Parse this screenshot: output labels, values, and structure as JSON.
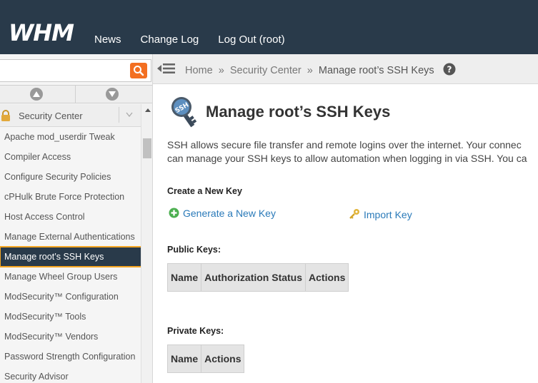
{
  "brand": {
    "logo_text": "WHM"
  },
  "topnav": {
    "items": [
      "News",
      "Change Log",
      "Log Out (root)"
    ]
  },
  "search": {
    "value": "",
    "placeholder": ""
  },
  "sidebar": {
    "category": "Security Center",
    "items": [
      "Apache mod_userdir Tweak",
      "Compiler Access",
      "Configure Security Policies",
      "cPHulk Brute Force Protection",
      "Host Access Control",
      "Manage External Authentications",
      "Manage root’s SSH Keys",
      "Manage Wheel Group Users",
      "ModSecurity™ Configuration",
      "ModSecurity™ Tools",
      "ModSecurity™ Vendors",
      "Password Strength Configuration",
      "Security Advisor"
    ],
    "active_index": 6
  },
  "breadcrumb": {
    "home": "Home",
    "section": "Security Center",
    "separator": "»",
    "current": "Manage root’s SSH Keys"
  },
  "page": {
    "title": "Manage root’s SSH Keys",
    "icon_text": "SSH",
    "description_line1": "SSH allows secure file transfer and remote logins over the internet. Your connec",
    "description_line2": "can manage your SSH keys to allow automation when logging in via SSH. You ca",
    "create_heading": "Create a New Key",
    "generate_label": "Generate a New Key",
    "import_label": "Import Key",
    "public_heading": "Public Keys:",
    "public_columns": [
      "Name",
      "Authorization Status",
      "Actions"
    ],
    "private_heading": "Private Keys:",
    "private_columns": [
      "Name",
      "Actions"
    ]
  },
  "colors": {
    "topbar": "#293a4a",
    "accent": "#f36f21",
    "link": "#2a7ab9",
    "highlight": "#f5a623"
  },
  "icons": [
    "search-icon",
    "arrow-up-icon",
    "arrow-down-icon",
    "lock-icon",
    "chevron-down-icon",
    "menu-toggle-icon",
    "help-icon",
    "ssh-key-icon",
    "plus-circle-icon",
    "key-import-icon"
  ]
}
